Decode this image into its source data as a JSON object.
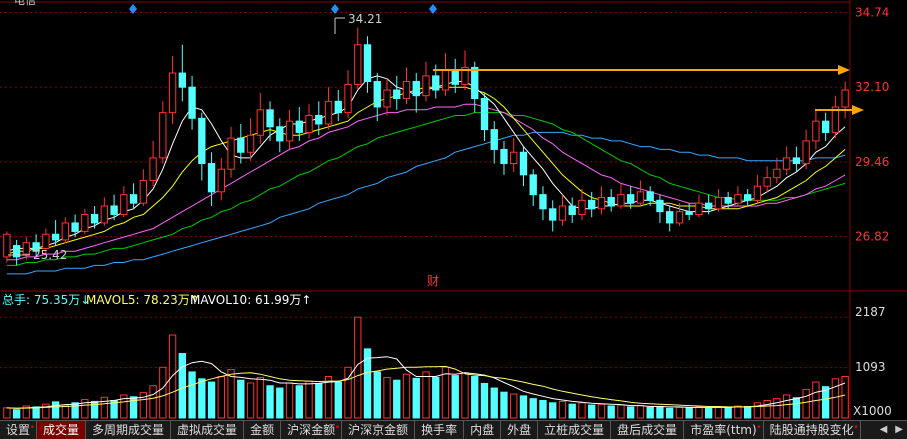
{
  "stock": {
    "name": "电信"
  },
  "price_axis": {
    "labels": [
      "34.74",
      "32.10",
      "29.46",
      "26.82"
    ],
    "values": [
      34.74,
      32.1,
      29.46,
      26.82
    ]
  },
  "volume_axis": {
    "labels": [
      "2187",
      "1093",
      "X1000"
    ],
    "values": [
      2187,
      1093
    ]
  },
  "annotations": {
    "high": "34.21",
    "low": "25.42",
    "event_marker": "财"
  },
  "volume_legend": {
    "total": "总手: 75.35万↓",
    "ma5": "MAVOL5: 78.23万↑",
    "ma10": "MAVOL10: 61.99万↑"
  },
  "colors": {
    "up": "#ff3232",
    "down": "#54ffff",
    "grid": "#8b0000",
    "axis_text": "#ff3232",
    "ma5": "#ffffff",
    "ma10": "#ffff00",
    "ma20": "#ff66ff",
    "ma30": "#00cc00",
    "ma60": "#33aaff",
    "arrow": "#ffa500"
  },
  "tabs": [
    {
      "label": "设置",
      "dot": true,
      "active": false
    },
    {
      "label": "成交量",
      "dot": false,
      "active": true
    },
    {
      "label": "多周期成交量",
      "dot": false,
      "active": false
    },
    {
      "label": "虚拟成交量",
      "dot": false,
      "active": false
    },
    {
      "label": "金额",
      "dot": false,
      "active": false
    },
    {
      "label": "沪深金额",
      "dot": true,
      "active": false
    },
    {
      "label": "沪深京金额",
      "dot": false,
      "active": false
    },
    {
      "label": "换手率",
      "dot": false,
      "active": false
    },
    {
      "label": "内盘",
      "dot": false,
      "active": false
    },
    {
      "label": "外盘",
      "dot": false,
      "active": false
    },
    {
      "label": "立桩成交量",
      "dot": false,
      "active": false
    },
    {
      "label": "盘后成交量",
      "dot": false,
      "active": false
    },
    {
      "label": "市盈率(ttm)",
      "dot": true,
      "active": false
    },
    {
      "label": "陆股通持股变化",
      "dot": true,
      "active": false
    }
  ],
  "chart_data": {
    "type": "candlestick",
    "price_range": [
      25.0,
      34.9
    ],
    "volume_range": [
      0,
      2300
    ],
    "candles": [
      [
        26.1,
        26.9,
        27.0,
        25.9
      ],
      [
        26.5,
        26.1,
        26.7,
        25.8
      ],
      [
        26.2,
        26.6,
        26.8,
        26.0
      ],
      [
        26.6,
        26.3,
        26.9,
        26.1
      ],
      [
        26.4,
        26.9,
        27.1,
        26.2
      ],
      [
        26.9,
        26.7,
        27.4,
        26.5
      ],
      [
        26.7,
        27.3,
        27.5,
        26.6
      ],
      [
        27.3,
        27.0,
        27.6,
        26.8
      ],
      [
        27.0,
        27.6,
        27.8,
        26.9
      ],
      [
        27.6,
        27.3,
        27.9,
        27.1
      ],
      [
        27.3,
        27.9,
        28.2,
        27.2
      ],
      [
        27.9,
        27.6,
        28.3,
        27.4
      ],
      [
        27.6,
        28.3,
        28.6,
        27.5
      ],
      [
        28.3,
        28.0,
        28.7,
        27.8
      ],
      [
        28.0,
        28.8,
        29.2,
        27.9
      ],
      [
        28.8,
        29.6,
        30.2,
        28.6
      ],
      [
        29.6,
        31.2,
        31.6,
        29.4
      ],
      [
        31.2,
        32.6,
        33.2,
        30.8
      ],
      [
        32.6,
        32.1,
        33.6,
        31.6
      ],
      [
        32.1,
        31.0,
        32.5,
        30.6
      ],
      [
        31.0,
        29.4,
        31.2,
        28.8
      ],
      [
        29.4,
        28.4,
        29.8,
        27.9
      ],
      [
        28.4,
        29.2,
        29.6,
        28.1
      ],
      [
        29.2,
        30.3,
        30.7,
        28.9
      ],
      [
        30.3,
        29.8,
        30.8,
        29.4
      ],
      [
        29.8,
        30.4,
        31.0,
        29.5
      ],
      [
        30.4,
        31.3,
        31.9,
        30.1
      ],
      [
        31.3,
        30.7,
        31.6,
        30.2
      ],
      [
        30.7,
        30.2,
        31.0,
        29.8
      ],
      [
        30.2,
        30.9,
        31.3,
        29.9
      ],
      [
        30.9,
        30.5,
        31.4,
        30.2
      ],
      [
        30.5,
        31.1,
        31.5,
        30.3
      ],
      [
        31.1,
        30.8,
        31.6,
        30.4
      ],
      [
        30.8,
        31.6,
        32.1,
        30.6
      ],
      [
        31.6,
        31.2,
        32.0,
        30.9
      ],
      [
        31.2,
        32.2,
        32.7,
        31.0
      ],
      [
        32.2,
        33.6,
        34.21,
        32.0
      ],
      [
        33.6,
        32.3,
        33.9,
        31.9
      ],
      [
        32.3,
        31.4,
        32.6,
        30.9
      ],
      [
        31.4,
        32.0,
        32.4,
        31.1
      ],
      [
        32.0,
        31.7,
        32.5,
        31.3
      ],
      [
        31.7,
        32.3,
        32.8,
        31.5
      ],
      [
        32.3,
        31.8,
        32.6,
        31.2
      ],
      [
        31.8,
        32.5,
        33.0,
        31.6
      ],
      [
        32.5,
        32.0,
        32.9,
        31.7
      ],
      [
        32.0,
        32.7,
        33.3,
        31.8
      ],
      [
        32.7,
        32.2,
        33.1,
        31.9
      ],
      [
        32.2,
        32.8,
        33.4,
        32.0
      ],
      [
        32.8,
        31.7,
        33.0,
        31.2
      ],
      [
        31.7,
        30.6,
        31.9,
        30.2
      ],
      [
        30.6,
        29.9,
        30.9,
        29.4
      ],
      [
        29.9,
        29.4,
        30.2,
        29.0
      ],
      [
        29.4,
        29.8,
        30.3,
        29.1
      ],
      [
        29.8,
        29.0,
        30.0,
        28.6
      ],
      [
        29.0,
        28.3,
        29.2,
        27.9
      ],
      [
        28.3,
        27.8,
        28.6,
        27.4
      ],
      [
        27.8,
        27.4,
        28.1,
        27.0
      ],
      [
        27.4,
        27.9,
        28.3,
        27.2
      ],
      [
        27.9,
        27.6,
        28.2,
        27.3
      ],
      [
        27.6,
        28.1,
        28.5,
        27.4
      ],
      [
        28.1,
        27.8,
        28.4,
        27.5
      ],
      [
        27.8,
        28.2,
        28.6,
        27.6
      ],
      [
        28.2,
        27.9,
        28.5,
        27.7
      ],
      [
        27.9,
        28.3,
        28.7,
        27.8
      ],
      [
        28.3,
        28.0,
        28.6,
        27.8
      ],
      [
        28.0,
        28.4,
        28.8,
        27.9
      ],
      [
        28.4,
        28.1,
        28.6,
        27.9
      ],
      [
        28.1,
        27.7,
        28.3,
        27.3
      ],
      [
        27.7,
        27.3,
        27.9,
        27.0
      ],
      [
        27.3,
        27.7,
        28.0,
        27.2
      ],
      [
        27.7,
        27.6,
        28.0,
        27.4
      ],
      [
        27.6,
        28.0,
        28.3,
        27.5
      ],
      [
        28.0,
        27.8,
        28.3,
        27.6
      ],
      [
        27.8,
        28.2,
        28.5,
        27.7
      ],
      [
        28.2,
        28.0,
        28.4,
        27.8
      ],
      [
        28.0,
        28.3,
        28.6,
        27.9
      ],
      [
        28.3,
        28.1,
        28.5,
        27.9
      ],
      [
        28.1,
        28.6,
        29.0,
        28.0
      ],
      [
        28.6,
        28.9,
        29.3,
        28.4
      ],
      [
        28.9,
        29.2,
        29.6,
        28.7
      ],
      [
        29.2,
        29.6,
        30.0,
        29.0
      ],
      [
        29.6,
        29.4,
        30.0,
        29.1
      ],
      [
        29.4,
        30.2,
        30.6,
        29.2
      ],
      [
        30.2,
        30.9,
        31.3,
        29.9
      ],
      [
        30.9,
        30.5,
        31.2,
        30.2
      ],
      [
        30.5,
        31.4,
        31.8,
        30.3
      ],
      [
        31.4,
        32.0,
        32.3,
        31.0
      ]
    ],
    "volumes": [
      220,
      180,
      260,
      240,
      300,
      350,
      280,
      330,
      400,
      360,
      450,
      380,
      500,
      460,
      550,
      700,
      1100,
      1800,
      1400,
      1000,
      850,
      780,
      900,
      1050,
      820,
      760,
      880,
      700,
      650,
      760,
      700,
      800,
      740,
      900,
      780,
      1100,
      2187,
      1500,
      1000,
      880,
      820,
      950,
      860,
      1000,
      880,
      1100,
      920,
      980,
      900,
      750,
      650,
      560,
      520,
      480,
      420,
      380,
      330,
      360,
      300,
      330,
      280,
      300,
      260,
      280,
      240,
      270,
      230,
      250,
      210,
      230,
      220,
      250,
      210,
      240,
      220,
      260,
      250,
      330,
      380,
      420,
      500,
      440,
      620,
      780,
      680,
      850,
      900
    ],
    "ma_lines": {
      "ma5": [
        26.3,
        26.4,
        26.4,
        26.4,
        26.5,
        26.6,
        26.8,
        26.9,
        27.1,
        27.2,
        27.4,
        27.5,
        27.7,
        27.8,
        28.1,
        28.5,
        29.2,
        30.1,
        30.9,
        31.4,
        31.3,
        30.8,
        30.2,
        29.7,
        29.6,
        29.6,
        30.0,
        30.4,
        30.6,
        30.8,
        30.8,
        30.9,
        31.0,
        31.1,
        31.2,
        31.4,
        32.0,
        32.4,
        32.5,
        32.4,
        32.1,
        32.0,
        31.8,
        32.0,
        32.1,
        32.2,
        32.3,
        32.3,
        32.1,
        31.8,
        31.5,
        31.0,
        30.5,
        30.0,
        29.6,
        29.2,
        28.7,
        28.3,
        27.9,
        27.8,
        27.8,
        27.9,
        27.9,
        28.0,
        28.0,
        28.1,
        28.1,
        28.0,
        27.9,
        27.8,
        27.7,
        27.7,
        27.7,
        27.8,
        27.9,
        28.0,
        28.1,
        28.2,
        28.4,
        28.6,
        28.9,
        29.1,
        29.4,
        29.8,
        30.0,
        30.4,
        30.7
      ],
      "ma10": [
        26.2,
        26.3,
        26.3,
        26.4,
        26.4,
        26.5,
        26.6,
        26.7,
        26.8,
        26.9,
        27.0,
        27.2,
        27.3,
        27.5,
        27.6,
        27.9,
        28.2,
        28.6,
        29.1,
        29.5,
        29.8,
        30.0,
        30.1,
        30.2,
        30.3,
        30.4,
        30.5,
        30.6,
        30.5,
        30.4,
        30.4,
        30.5,
        30.6,
        30.7,
        30.8,
        30.9,
        31.2,
        31.4,
        31.6,
        31.7,
        31.8,
        31.9,
        32.0,
        32.1,
        32.1,
        32.1,
        32.1,
        32.1,
        32.0,
        31.9,
        31.7,
        31.4,
        31.0,
        30.6,
        30.2,
        29.8,
        29.4,
        29.0,
        28.7,
        28.4,
        28.2,
        28.1,
        28.0,
        27.9,
        27.9,
        27.9,
        28.0,
        28.0,
        28.0,
        27.9,
        27.9,
        27.9,
        27.8,
        27.8,
        27.8,
        27.8,
        27.9,
        28.0,
        28.1,
        28.2,
        28.4,
        28.6,
        28.8,
        29.1,
        29.3,
        29.6,
        29.9
      ],
      "ma20": [
        26.0,
        26.0,
        26.1,
        26.1,
        26.2,
        26.2,
        26.3,
        26.3,
        26.4,
        26.5,
        26.6,
        26.7,
        26.8,
        26.9,
        27.0,
        27.1,
        27.3,
        27.5,
        27.7,
        27.9,
        28.1,
        28.3,
        28.5,
        28.7,
        28.9,
        29.1,
        29.3,
        29.5,
        29.7,
        29.9,
        30.0,
        30.2,
        30.3,
        30.5,
        30.6,
        30.7,
        30.9,
        31.0,
        31.1,
        31.2,
        31.2,
        31.3,
        31.3,
        31.3,
        31.4,
        31.4,
        31.4,
        31.5,
        31.5,
        31.4,
        31.3,
        31.2,
        31.0,
        30.8,
        30.6,
        30.3,
        30.1,
        29.8,
        29.6,
        29.4,
        29.2,
        29.0,
        28.9,
        28.7,
        28.6,
        28.5,
        28.4,
        28.3,
        28.2,
        28.1,
        28.0,
        28.0,
        27.9,
        27.9,
        27.9,
        27.9,
        27.9,
        27.9,
        28.0,
        28.0,
        28.1,
        28.2,
        28.3,
        28.5,
        28.6,
        28.8,
        29.0
      ],
      "ma30": [
        25.8,
        25.8,
        25.9,
        25.9,
        26.0,
        26.0,
        26.1,
        26.1,
        26.2,
        26.2,
        26.3,
        26.4,
        26.4,
        26.5,
        26.6,
        26.7,
        26.8,
        26.9,
        27.1,
        27.2,
        27.4,
        27.5,
        27.7,
        27.8,
        28.0,
        28.1,
        28.3,
        28.5,
        28.6,
        28.8,
        29.0,
        29.1,
        29.3,
        29.5,
        29.6,
        29.8,
        30.0,
        30.1,
        30.3,
        30.4,
        30.5,
        30.6,
        30.7,
        30.8,
        30.9,
        31.0,
        31.1,
        31.1,
        31.2,
        31.2,
        31.2,
        31.2,
        31.1,
        31.1,
        31.0,
        30.9,
        30.8,
        30.6,
        30.5,
        30.3,
        30.1,
        29.9,
        29.7,
        29.5,
        29.4,
        29.2,
        29.0,
        28.9,
        28.7,
        28.6,
        28.5,
        28.4,
        28.3,
        28.2,
        28.2,
        28.1,
        28.1,
        28.1,
        28.1,
        28.1,
        28.2,
        28.2,
        28.3,
        28.4,
        28.5,
        28.6,
        28.7
      ],
      "ma60": [
        25.5,
        25.5,
        25.5,
        25.6,
        25.6,
        25.6,
        25.7,
        25.7,
        25.7,
        25.8,
        25.8,
        25.9,
        25.9,
        26.0,
        26.0,
        26.1,
        26.2,
        26.3,
        26.4,
        26.5,
        26.6,
        26.7,
        26.8,
        26.9,
        27.0,
        27.1,
        27.2,
        27.3,
        27.5,
        27.6,
        27.7,
        27.8,
        28.0,
        28.1,
        28.2,
        28.3,
        28.5,
        28.6,
        28.7,
        28.9,
        29.0,
        29.1,
        29.3,
        29.4,
        29.5,
        29.6,
        29.8,
        29.9,
        30.0,
        30.1,
        30.2,
        30.3,
        30.4,
        30.4,
        30.5,
        30.5,
        30.5,
        30.5,
        30.4,
        30.4,
        30.3,
        30.3,
        30.2,
        30.2,
        30.1,
        30.0,
        30.0,
        29.9,
        29.9,
        29.8,
        29.8,
        29.7,
        29.7,
        29.6,
        29.6,
        29.6,
        29.5,
        29.5,
        29.5,
        29.5,
        29.5,
        29.5,
        29.5,
        29.6,
        29.6,
        29.6,
        29.7
      ]
    },
    "vol_ma": {
      "ma5": [
        220,
        210,
        220,
        230,
        240,
        270,
        290,
        300,
        330,
        340,
        360,
        380,
        420,
        430,
        450,
        510,
        650,
        920,
        1110,
        1200,
        1230,
        1180,
        1000,
        900,
        880,
        850,
        840,
        820,
        760,
        760,
        740,
        740,
        750,
        780,
        790,
        860,
        1160,
        1300,
        1310,
        1330,
        1280,
        1040,
        900,
        900,
        900,
        960,
        950,
        980,
        960,
        930,
        870,
        770,
        680,
        580,
        520,
        470,
        420,
        390,
        360,
        340,
        320,
        310,
        300,
        290,
        270,
        270,
        250,
        250,
        240,
        240,
        230,
        230,
        230,
        230,
        230,
        240,
        240,
        260,
        290,
        330,
        380,
        420,
        470,
        560,
        600,
        680,
        760
      ],
      "ma10": [
        220,
        210,
        215,
        220,
        230,
        240,
        250,
        260,
        280,
        290,
        310,
        330,
        350,
        380,
        400,
        430,
        480,
        560,
        650,
        720,
        790,
        850,
        900,
        950,
        970,
        980,
        950,
        900,
        850,
        820,
        810,
        800,
        790,
        800,
        800,
        830,
        920,
        990,
        1020,
        1060,
        1080,
        1100,
        1100,
        1110,
        1110,
        1120,
        1060,
        960,
        930,
        920,
        880,
        860,
        820,
        780,
        730,
        690,
        630,
        580,
        540,
        500,
        460,
        430,
        400,
        370,
        340,
        320,
        310,
        300,
        290,
        280,
        270,
        260,
        250,
        250,
        240,
        240,
        240,
        250,
        260,
        270,
        290,
        310,
        340,
        380,
        410,
        450,
        500
      ]
    }
  }
}
